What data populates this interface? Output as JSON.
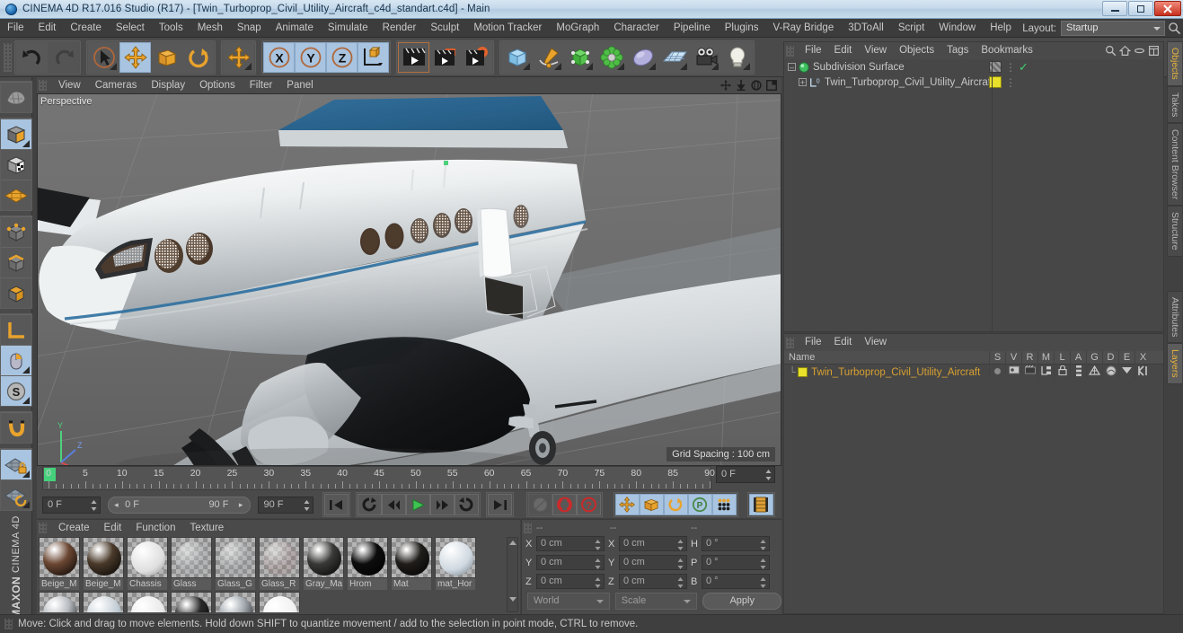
{
  "window": {
    "title": "CINEMA 4D R17.016 Studio (R17) - [Twin_Turboprop_Civil_Utility_Aircraft_c4d_standart.c4d] - Main",
    "app_icon": "c4d-logo-icon",
    "minimize_label": "Minimize",
    "maximize_label": "Restore",
    "close_label": "Close"
  },
  "menubar": {
    "items": [
      "File",
      "Edit",
      "Create",
      "Select",
      "Tools",
      "Mesh",
      "Snap",
      "Animate",
      "Simulate",
      "Render",
      "Sculpt",
      "Motion Tracker",
      "MoGraph",
      "Character",
      "Pipeline",
      "Plugins",
      "V-Ray Bridge",
      "3DToAll",
      "Script",
      "Window",
      "Help"
    ],
    "layout_label": "Layout:",
    "layout_value": "Startup",
    "search_icon": "search-icon"
  },
  "main_toolbar": {
    "groups": [
      {
        "buttons": [
          {
            "name": "undo-button",
            "icon": "undo-arrow-icon",
            "selected": false,
            "enabled": true
          },
          {
            "name": "redo-button",
            "icon": "redo-arrow-icon",
            "selected": false,
            "enabled": false
          }
        ]
      },
      {
        "buttons": [
          {
            "name": "live-selection-tool",
            "icon": "cursor-arrow-icon",
            "selected": false,
            "enabled": true
          },
          {
            "name": "move-tool",
            "icon": "move-cross-icon",
            "selected": true,
            "enabled": true
          },
          {
            "name": "scale-tool",
            "icon": "scale-box-icon",
            "selected": false,
            "enabled": true
          },
          {
            "name": "rotate-tool",
            "icon": "rotate-arc-icon",
            "selected": false,
            "enabled": true
          }
        ]
      },
      {
        "buttons": [
          {
            "name": "move-alt-tool",
            "icon": "move-cross-icon",
            "selected": false,
            "enabled": true
          }
        ]
      },
      {
        "buttons": [
          {
            "name": "x-axis-lock",
            "icon": "x-axis-icon",
            "selected": true,
            "enabled": true
          },
          {
            "name": "y-axis-lock",
            "icon": "y-axis-icon",
            "selected": true,
            "enabled": true
          },
          {
            "name": "z-axis-lock",
            "icon": "z-axis-icon",
            "selected": true,
            "enabled": true
          },
          {
            "name": "world-object-coordinate-toggle",
            "icon": "world-axis-cube-icon",
            "selected": true,
            "enabled": true
          }
        ]
      },
      {
        "buttons": [
          {
            "name": "render-view-button",
            "icon": "clapperboard-icon",
            "selected": false,
            "enabled": true
          },
          {
            "name": "render-to-picture-viewer",
            "icon": "clapperboard-red-icon",
            "selected": false,
            "enabled": true
          },
          {
            "name": "render-settings-button",
            "icon": "clapperboard-gear-icon",
            "selected": false,
            "enabled": true
          }
        ]
      },
      {
        "buttons": [
          {
            "name": "add-cube-object",
            "icon": "cube-icon",
            "selected": false,
            "enabled": true
          },
          {
            "name": "add-spline-object",
            "icon": "pen-spline-icon",
            "selected": false,
            "enabled": true
          },
          {
            "name": "add-generator",
            "icon": "green-cube-icon",
            "selected": false,
            "enabled": true
          },
          {
            "name": "add-deformer",
            "icon": "green-flower-icon",
            "selected": false,
            "enabled": true
          },
          {
            "name": "add-environment",
            "icon": "sky-blob-icon",
            "selected": false,
            "enabled": true
          },
          {
            "name": "add-floor-scene",
            "icon": "grid-plane-icon",
            "selected": false,
            "enabled": true
          },
          {
            "name": "add-camera",
            "icon": "camera-icon",
            "selected": false,
            "enabled": true
          },
          {
            "name": "add-light",
            "icon": "lightbulb-icon",
            "selected": false,
            "enabled": true
          }
        ]
      }
    ]
  },
  "left_toolbar": {
    "groups": [
      {
        "buttons": [
          {
            "name": "make-editable-button",
            "icon": "make-editable-icon",
            "selected": false
          }
        ]
      },
      {
        "buttons": [
          {
            "name": "model-mode-button",
            "icon": "model-cube-icon",
            "selected": true
          },
          {
            "name": "texture-mode-button",
            "icon": "texture-cube-icon",
            "selected": false
          },
          {
            "name": "workplane-mode-button",
            "icon": "workplane-grid-icon",
            "selected": false
          }
        ]
      },
      {
        "buttons": [
          {
            "name": "points-mode-button",
            "icon": "points-cube-icon",
            "selected": false
          },
          {
            "name": "edges-mode-button",
            "icon": "edges-cube-icon",
            "selected": false
          },
          {
            "name": "polygons-mode-button",
            "icon": "polygons-cube-icon",
            "selected": false
          }
        ]
      },
      {
        "buttons": [
          {
            "name": "object-axis-mode-button",
            "icon": "axis-corner-icon",
            "selected": false
          },
          {
            "name": "enable-axis-modification",
            "icon": "mouse-axis-icon",
            "selected": true
          },
          {
            "name": "enable-snapping-button",
            "icon": "s-circle-icon",
            "selected": true
          }
        ]
      },
      {
        "buttons": [
          {
            "name": "magnet-tool-button",
            "icon": "magnet-icon",
            "selected": false
          }
        ]
      },
      {
        "buttons": [
          {
            "name": "lock-workplane-button",
            "icon": "workplane-lock-icon",
            "selected": true
          },
          {
            "name": "planar-workplane-button",
            "icon": "workplane-rotate-icon",
            "selected": false
          }
        ]
      }
    ],
    "brand_top": "MAXON",
    "brand_bottom": "CINEMA 4D"
  },
  "viewport": {
    "menu_items": [
      "View",
      "Cameras",
      "Display",
      "Options",
      "Filter",
      "Panel"
    ],
    "label": "Perspective",
    "grid_spacing": "Grid Spacing : 100 cm",
    "corner_icons": [
      "pan-view-icon",
      "dolly-view-icon",
      "rotate-view-icon",
      "maximize-view-icon"
    ],
    "axis_gizmo": {
      "x": "X",
      "y": "Y",
      "z": "Z"
    }
  },
  "timeline": {
    "tick_labels": [
      "0",
      "5",
      "10",
      "15",
      "20",
      "25",
      "30",
      "35",
      "40",
      "45",
      "50",
      "55",
      "60",
      "65",
      "70",
      "75",
      "80",
      "85",
      "90"
    ],
    "playhead_frame": "0 F",
    "current_frame_field": "0 F",
    "range_start": "0 F",
    "range_end": "90 F",
    "preview_end_field": "90 F",
    "right_frame_field": "0 F",
    "buttons": [
      {
        "name": "go-to-start-button",
        "icon": "skip-start-icon"
      },
      {
        "name": "play-backwards-loop-button",
        "icon": "loop-icon"
      },
      {
        "name": "go-to-previous-frame-button",
        "icon": "step-back-icon"
      },
      {
        "name": "play-button",
        "icon": "play-icon"
      },
      {
        "name": "go-to-next-frame-button",
        "icon": "step-forward-icon"
      },
      {
        "name": "play-forwards-loop-button",
        "icon": "loop-forward-icon"
      },
      {
        "name": "go-to-end-button",
        "icon": "skip-end-icon"
      },
      {
        "name": "record-active-objects-button",
        "icon": "record-disabled-icon"
      },
      {
        "name": "autokeying-button",
        "icon": "autokey-icon"
      },
      {
        "name": "keyframe-selection-button",
        "icon": "question-key-icon"
      },
      {
        "name": "position-key-toggle",
        "icon": "position-cross-icon"
      },
      {
        "name": "scale-key-toggle",
        "icon": "scale-box-icon"
      },
      {
        "name": "rotation-key-toggle",
        "icon": "rotate-arc-icon"
      },
      {
        "name": "parameter-key-toggle",
        "icon": "p-circle-icon"
      },
      {
        "name": "point-level-animation-toggle",
        "icon": "pla-dots-icon"
      },
      {
        "name": "timeline-window-button",
        "icon": "timeline-strip-icon"
      }
    ]
  },
  "material_manager": {
    "menu_items": [
      "Create",
      "Edit",
      "Function",
      "Texture"
    ],
    "materials_row1": [
      {
        "name": "Beige_M",
        "color": "#6b4733",
        "type": "glossy"
      },
      {
        "name": "Beige_M",
        "color": "#4a3a2a",
        "type": "glossy"
      },
      {
        "name": "Chassis",
        "color": "#dedede",
        "type": "matte"
      },
      {
        "name": "Glass",
        "color": "#aeb4b8",
        "type": "transparent"
      },
      {
        "name": "Glass_G",
        "color": "#9aa0a4",
        "type": "transparent"
      },
      {
        "name": "Glass_R",
        "color": "#a47878",
        "type": "transparent"
      },
      {
        "name": "Gray_Ma",
        "color": "#3a3a38",
        "type": "glossy"
      },
      {
        "name": "Hrom",
        "color": "#0d0d0d",
        "type": "glossy"
      },
      {
        "name": "Mat",
        "color": "#201d1a",
        "type": "glossy"
      },
      {
        "name": "mat_Hor",
        "color": "#cfd8e0",
        "type": "textured"
      }
    ],
    "materials_row2": [
      {
        "name": "",
        "color": "#b8bcc0",
        "type": "glossy"
      },
      {
        "name": "",
        "color": "#c0cad2",
        "type": "textured"
      },
      {
        "name": "",
        "color": "#e8e8e8",
        "type": "matte"
      },
      {
        "name": "",
        "color": "#2a2a2a",
        "type": "glossy"
      },
      {
        "name": "",
        "color": "#9fa6ac",
        "type": "glossy"
      },
      {
        "name": "",
        "color": "#efefef",
        "type": "matte"
      }
    ]
  },
  "coordinates_manager": {
    "header_cols": [
      "--",
      "--",
      "--"
    ],
    "position": {
      "label_x": "X",
      "x": "0 cm",
      "label_y": "Y",
      "y": "0 cm",
      "label_z": "Z",
      "z": "0 cm"
    },
    "size": {
      "label_x": "X",
      "x": "0 cm",
      "label_y": "Y",
      "y": "0 cm",
      "label_z": "Z",
      "z": "0 cm"
    },
    "rotation": {
      "label_h": "H",
      "h": "0 °",
      "label_p": "P",
      "p": "0 °",
      "label_b": "B",
      "b": "0 °"
    },
    "coord_system": "World",
    "size_mode": "Scale",
    "apply_label": "Apply"
  },
  "object_manager": {
    "menu_items": [
      "File",
      "Edit",
      "View",
      "Objects",
      "Tags",
      "Bookmarks"
    ],
    "header_icons": [
      "search-icon",
      "home-icon",
      "minus-icon",
      "fit-icon"
    ],
    "rows": [
      {
        "name": "Subdivision Surface",
        "icon": "subdivision-surface-icon",
        "indent": 0,
        "expanded": true,
        "color": "#c5c5c5",
        "tags": [
          "checker-tag",
          "green-check-tag"
        ]
      },
      {
        "name": "Twin_Turboprop_Civil_Utility_Aircraft",
        "icon": "null-layer-icon",
        "indent": 1,
        "expanded": false,
        "color": "#c5c5c5",
        "tags": [
          "yellow-material-tag"
        ]
      }
    ]
  },
  "attribute_manager": {
    "menu_items": [
      "File",
      "Edit",
      "View"
    ],
    "name_col_header": "Name",
    "columns": [
      "S",
      "V",
      "R",
      "M",
      "L",
      "A",
      "G",
      "D",
      "E",
      "X"
    ],
    "rows": [
      {
        "name": "Twin_Turboprop_Civil_Utility_Aircraft",
        "swatch_color": "#e8e02a",
        "text_color": "#d8a030",
        "icons": [
          "solo-dot-icon",
          "visible-icon",
          "render-icon",
          "manager-icon",
          "lock-icon",
          "animate-icon",
          "generator-icon",
          "deformer-icon",
          "expression-icon",
          "xref-icon"
        ]
      }
    ]
  },
  "right_tabs": {
    "top_group": [
      {
        "label": "Objects",
        "active": true
      },
      {
        "label": "Takes",
        "active": false
      },
      {
        "label": "Content Browser",
        "active": false
      },
      {
        "label": "Structure",
        "active": false
      }
    ],
    "bottom_group": [
      {
        "label": "Attributes",
        "active": false
      },
      {
        "label": "Layers",
        "active": true
      }
    ]
  },
  "statusbar": {
    "text": "Move: Click and drag to move elements. Hold down SHIFT to quantize movement / add to the selection in point mode, CTRL to remove."
  },
  "colors": {
    "accent_selected": "#a8c4e0",
    "orange": "#e08b20",
    "highlight_yellow": "#d8a030",
    "green": "#45d17c",
    "background": "#4a4a4a"
  }
}
